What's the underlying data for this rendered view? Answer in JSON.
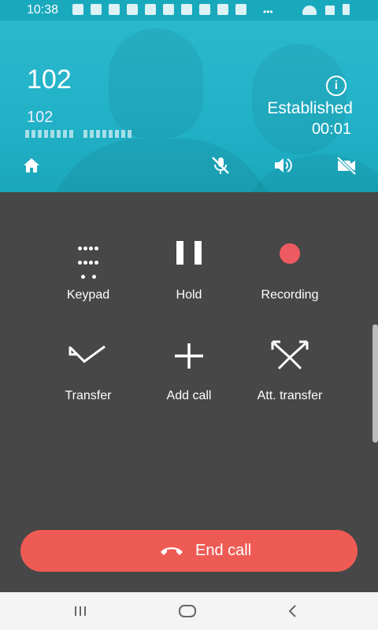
{
  "status_bar": {
    "time": "10:38"
  },
  "call": {
    "number": "102",
    "sub_number": "102",
    "state": "Established",
    "duration": "00:01"
  },
  "header_icons": [
    "home-icon",
    "mic-off-icon",
    "speaker-icon",
    "video-off-icon",
    "info-icon"
  ],
  "actions": [
    {
      "label": "Keypad",
      "icon": "keypad-icon"
    },
    {
      "label": "Hold",
      "icon": "pause-icon"
    },
    {
      "label": "Recording",
      "icon": "record-icon"
    },
    {
      "label": "Transfer",
      "icon": "transfer-icon"
    },
    {
      "label": "Add call",
      "icon": "plus-icon"
    },
    {
      "label": "Att. transfer",
      "icon": "attended-transfer-icon"
    }
  ],
  "end_call": {
    "label": "End call",
    "color": "#EE5B54"
  },
  "colors": {
    "header": "#22B2C8",
    "background": "#474747",
    "record": "#EE5A61"
  },
  "nav": [
    "recent-apps-icon",
    "home-button-icon",
    "back-icon"
  ]
}
